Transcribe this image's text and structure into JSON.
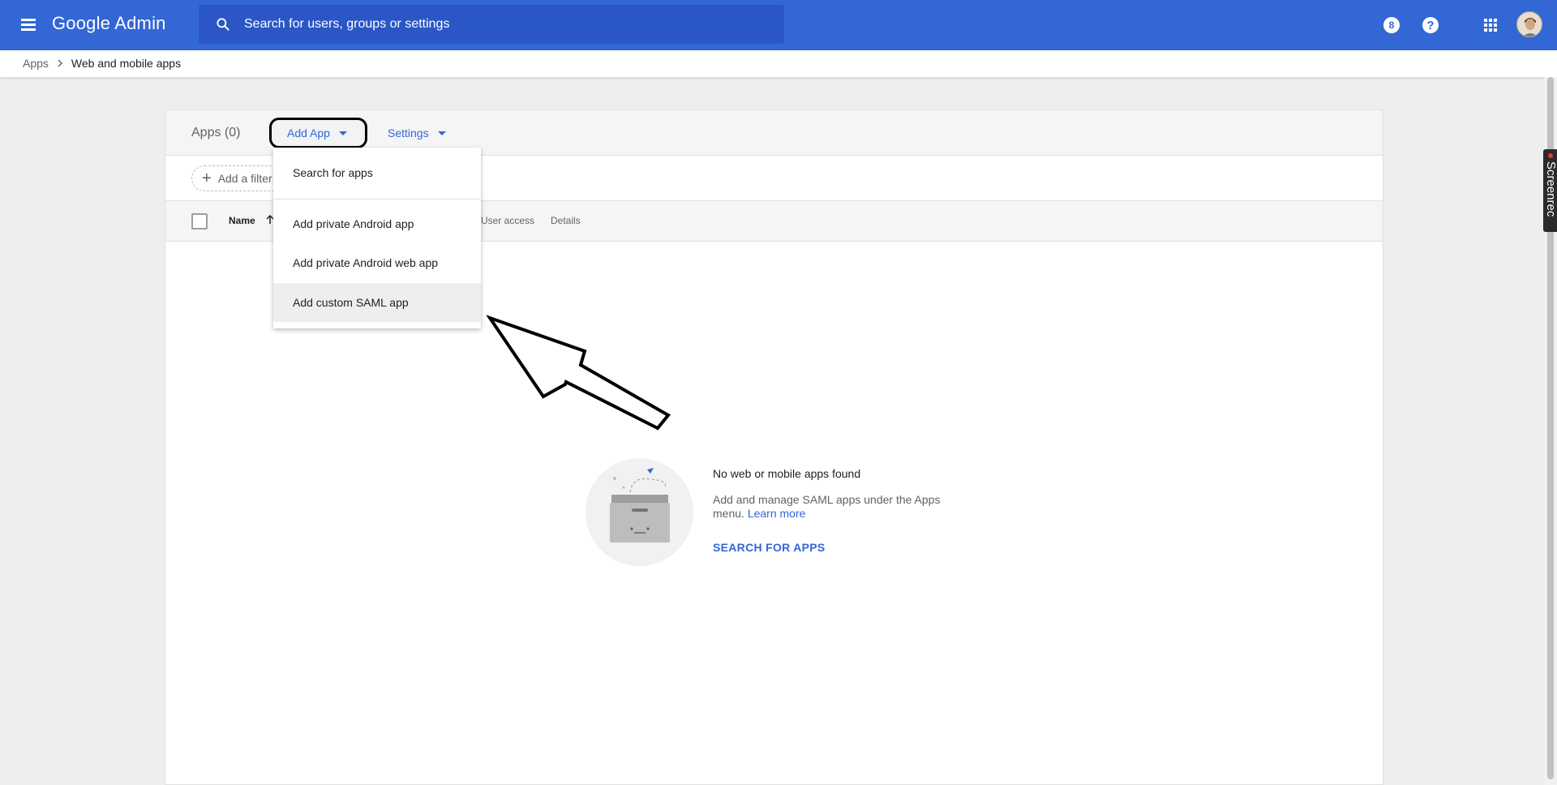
{
  "topbar": {
    "brand": "Google Admin",
    "search_placeholder": "Search for users, groups or settings",
    "counter_badge": "8",
    "help_glyph": "?",
    "bg_color": "#3367d6"
  },
  "breadcrumb": {
    "items": [
      "Apps",
      "Web and mobile apps"
    ]
  },
  "apps_header": {
    "count_label": "Apps (0)",
    "add_app_label": "Add App",
    "settings_label": "Settings"
  },
  "filter": {
    "add_filter_label": "Add a filter"
  },
  "table": {
    "columns": [
      "Name",
      "User access",
      "Details"
    ]
  },
  "dropdown": {
    "items": [
      "Search for apps",
      "Add private Android app",
      "Add private Android web app",
      "Add custom SAML app"
    ],
    "highlighted": "Add custom SAML app"
  },
  "empty_state": {
    "title": "No web or mobile apps found",
    "description": "Add and manage SAML apps under the Apps menu.",
    "learn_more": "Learn more",
    "action": "SEARCH FOR APPS"
  },
  "recorder": {
    "label": "Screenrec"
  },
  "icons": [
    "menu-icon",
    "search-icon",
    "help-icon",
    "apps-grid-icon",
    "chevron-right-icon",
    "arrow-up-icon",
    "plus-icon",
    "annotation-arrow",
    "empty-box-illustration"
  ]
}
